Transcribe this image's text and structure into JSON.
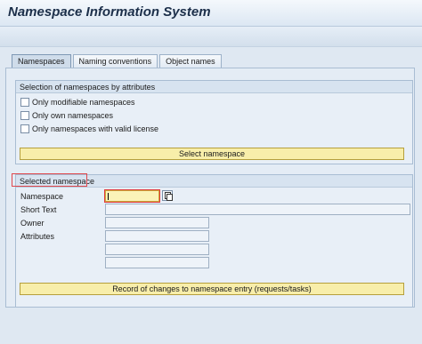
{
  "window": {
    "title": "Namespace Information System"
  },
  "tabs": [
    {
      "label": "Namespaces",
      "active": true
    },
    {
      "label": "Naming conventions",
      "active": false
    },
    {
      "label": "Object names",
      "active": false
    }
  ],
  "attributes_group": {
    "title": "Selection of namespaces by attributes",
    "options": [
      {
        "label": "Only modifiable namespaces",
        "checked": false
      },
      {
        "label": "Only own namespaces",
        "checked": false
      },
      {
        "label": "Only namespaces with valid license",
        "checked": false
      }
    ],
    "select_button": "Select namespace"
  },
  "selected_group": {
    "title": "Selected namespace",
    "fields": {
      "namespace_label": "Namespace",
      "namespace_value": "",
      "short_text_label": "Short Text",
      "owner_label": "Owner",
      "attributes_label": "Attributes"
    },
    "record_button": "Record of changes to namespace entry (requests/tasks)"
  },
  "colors": {
    "button_yellow": "#f8eeaa",
    "highlight_red": "#e0474c",
    "active_input": "#fbf3b8"
  }
}
